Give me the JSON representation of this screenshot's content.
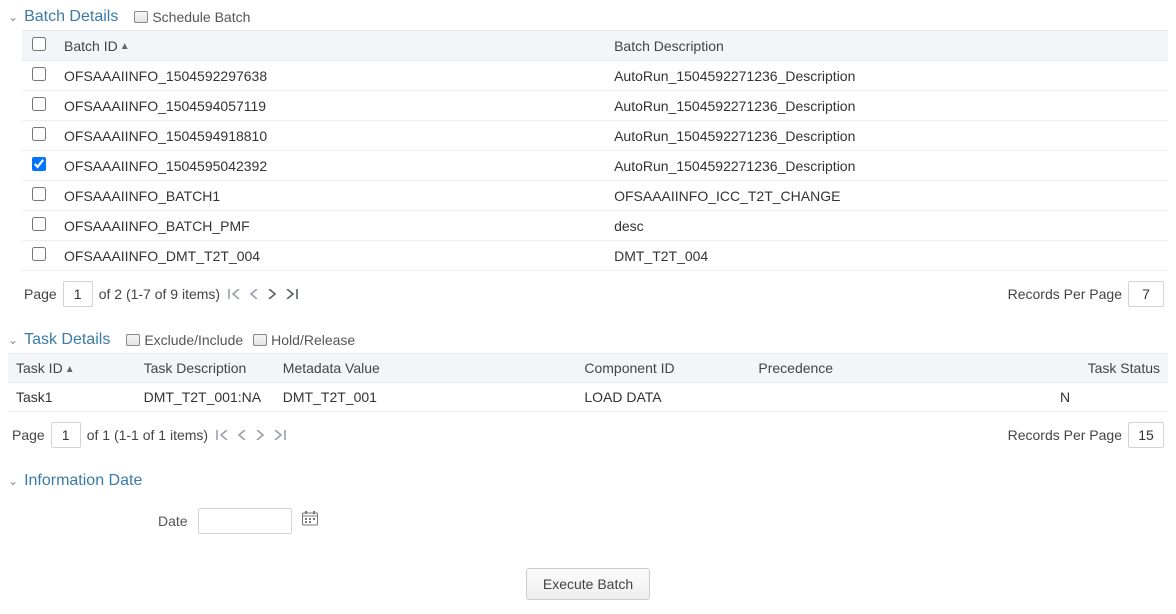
{
  "batchDetails": {
    "title": "Batch Details",
    "scheduleLabel": "Schedule Batch",
    "columns": {
      "id": "Batch ID",
      "desc": "Batch Description"
    },
    "rows": [
      {
        "checked": false,
        "id": "OFSAAAIINFO_1504592297638",
        "desc": "AutoRun_1504592271236_Description"
      },
      {
        "checked": false,
        "id": "OFSAAAIINFO_1504594057119",
        "desc": "AutoRun_1504592271236_Description"
      },
      {
        "checked": false,
        "id": "OFSAAAIINFO_1504594918810",
        "desc": "AutoRun_1504592271236_Description"
      },
      {
        "checked": true,
        "id": "OFSAAAIINFO_1504595042392",
        "desc": "AutoRun_1504592271236_Description"
      },
      {
        "checked": false,
        "id": "OFSAAAIINFO_BATCH1",
        "desc": "OFSAAAIINFO_ICC_T2T_CHANGE"
      },
      {
        "checked": false,
        "id": "OFSAAAIINFO_BATCH_PMF",
        "desc": "desc"
      },
      {
        "checked": false,
        "id": "OFSAAAIINFO_DMT_T2T_004",
        "desc": "DMT_T2T_004"
      }
    ],
    "pager": {
      "pageLabel": "Page",
      "page": "1",
      "ofText": "of 2 (1-7 of 9 items)",
      "recordsPerPageLabel": "Records Per Page",
      "recordsPerPage": "7"
    }
  },
  "taskDetails": {
    "title": "Task Details",
    "excludeInclude": "Exclude/Include",
    "holdRelease": "Hold/Release",
    "columns": {
      "taskId": "Task ID",
      "taskDesc": "Task Description",
      "meta": "Metadata Value",
      "compId": "Component ID",
      "prec": "Precedence",
      "status": "Task Status"
    },
    "rows": [
      {
        "taskId": "Task1",
        "taskDesc": "DMT_T2T_001:NA",
        "meta": "DMT_T2T_001",
        "compId": "LOAD DATA",
        "prec": "",
        "status": "N"
      }
    ],
    "pager": {
      "pageLabel": "Page",
      "page": "1",
      "ofText": "of 1 (1-1 of 1 items)",
      "recordsPerPageLabel": "Records Per Page",
      "recordsPerPage": "15"
    }
  },
  "infoDate": {
    "title": "Information Date",
    "dateLabel": "Date",
    "dateValue": ""
  },
  "execute": {
    "label": "Execute Batch"
  },
  "glyph": {
    "chevDown": "⌄",
    "sortUp": "▲",
    "first": "❮❮",
    "prev": "❮",
    "next": "❯",
    "last": "❯❮"
  }
}
